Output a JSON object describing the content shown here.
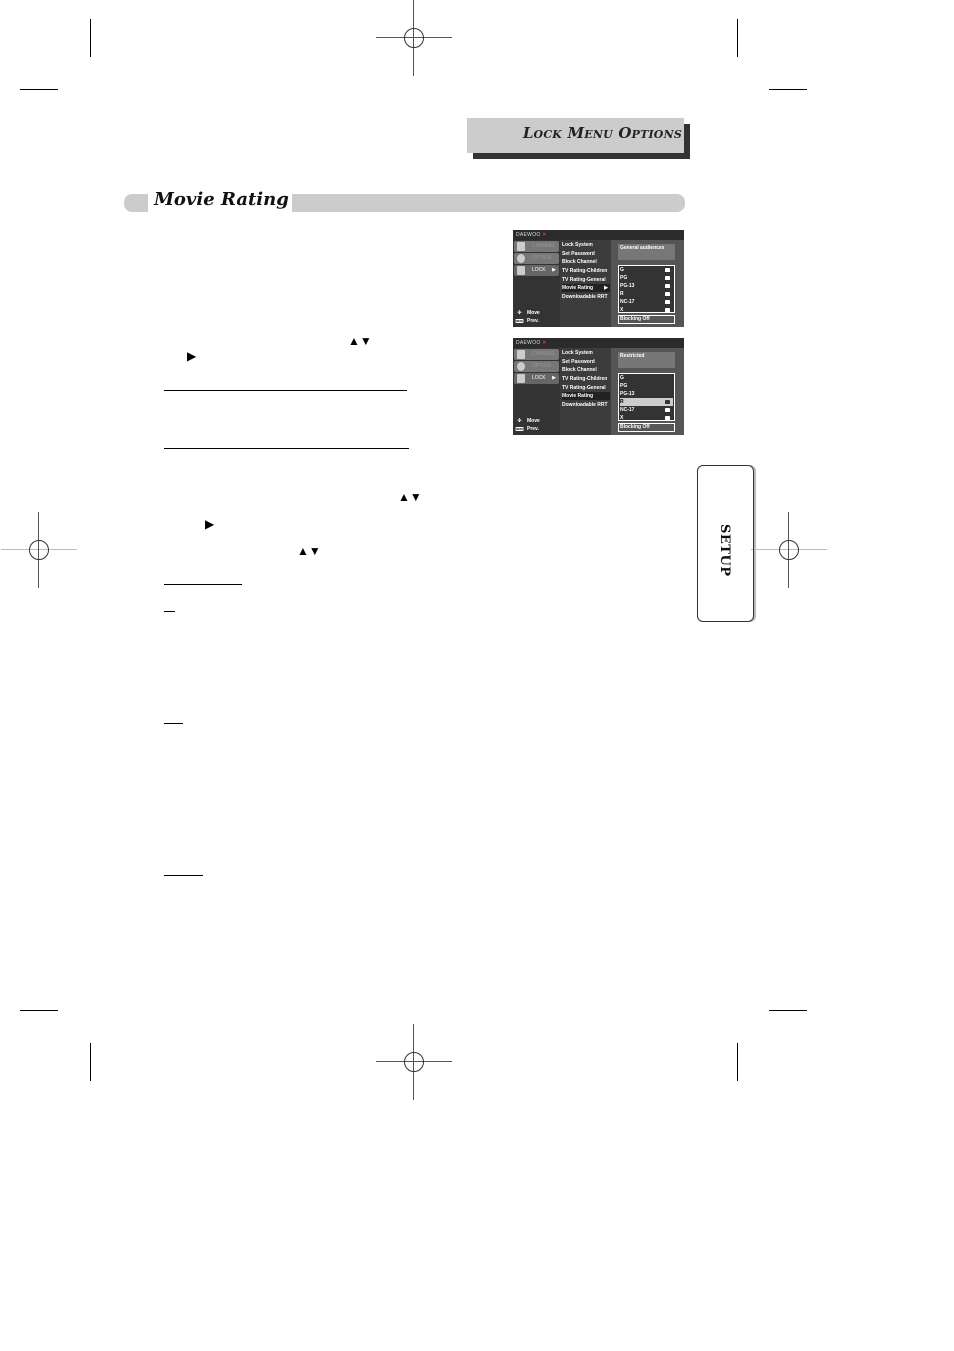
{
  "header": {
    "section_title": "Lock Menu Options"
  },
  "section": {
    "title": "Movie Rating"
  },
  "side_tab": {
    "label": "SETUP"
  },
  "arrows": {
    "up_down": "▲▼",
    "right": "▶"
  },
  "osd_screens": [
    {
      "brand": "DAEWOO",
      "brand_mark": "✕",
      "tabs": [
        {
          "label": "CHANNEL",
          "icon": "tv-icon"
        },
        {
          "label": "OPTION",
          "icon": "gear-icon"
        },
        {
          "label": "LOCK",
          "icon": "lock-icon",
          "selected": true
        }
      ],
      "menu_items": [
        "Lock System",
        "Set Password",
        "Block Channel",
        "TV Rating-Children",
        "TV Rating-General",
        "Movie Rating",
        "Downloadable RRT"
      ],
      "selected_menu_item": "Movie Rating",
      "description": "General audiences",
      "ratings": [
        {
          "label": "G",
          "locked": true
        },
        {
          "label": "PG",
          "locked": true
        },
        {
          "label": "PG-13",
          "locked": true
        },
        {
          "label": "R",
          "locked": true
        },
        {
          "label": "NC-17",
          "locked": true
        },
        {
          "label": "X",
          "locked": true
        }
      ],
      "highlighted_rating": null,
      "blocking": "Blocking Off",
      "nav": [
        {
          "key": "✣",
          "label": "Move"
        },
        {
          "key": "MENU",
          "label": "Prev."
        }
      ]
    },
    {
      "brand": "DAEWOO",
      "brand_mark": "✕",
      "tabs": [
        {
          "label": "CHANNEL",
          "icon": "tv-icon"
        },
        {
          "label": "OPTION",
          "icon": "gear-icon"
        },
        {
          "label": "LOCK",
          "icon": "lock-icon",
          "selected": true
        }
      ],
      "menu_items": [
        "Lock System",
        "Set Password",
        "Block Channel",
        "TV Rating-Children",
        "TV Rating-General",
        "Movie Rating",
        "Downloadable RRT"
      ],
      "selected_menu_item": "Movie Rating",
      "description": "Restricted",
      "ratings": [
        {
          "label": "G",
          "locked": false
        },
        {
          "label": "PG",
          "locked": false
        },
        {
          "label": "PG-13",
          "locked": false
        },
        {
          "label": "R",
          "locked": true
        },
        {
          "label": "NC-17",
          "locked": true
        },
        {
          "label": "X",
          "locked": true
        }
      ],
      "highlighted_rating": "R",
      "blocking": "Blocking Off",
      "nav": [
        {
          "key": "✣",
          "label": "Move"
        },
        {
          "key": "MENU",
          "label": "Prev."
        }
      ]
    }
  ]
}
